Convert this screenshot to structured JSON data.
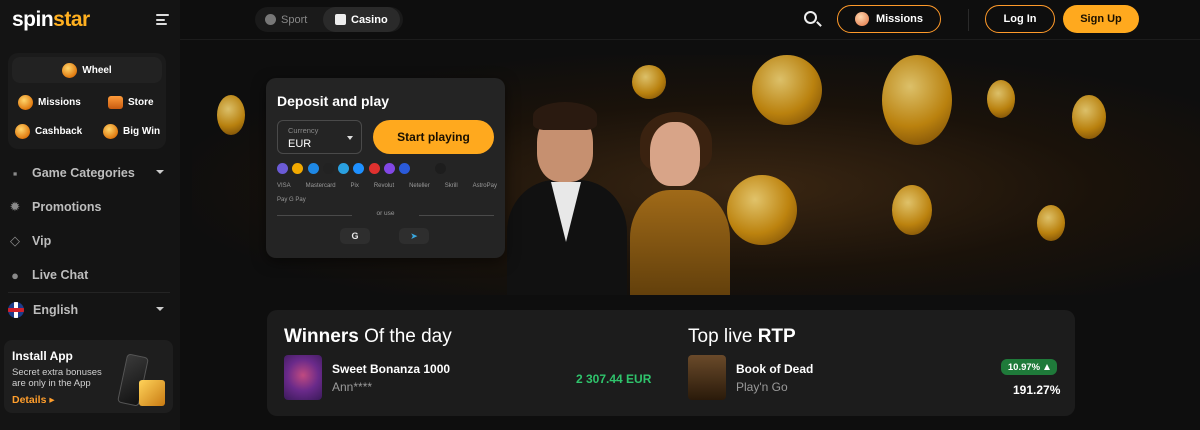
{
  "brand": {
    "logo_prefix": "spin",
    "logo_suffix": "star"
  },
  "sidebar": {
    "promos": [
      {
        "label": "Wheel",
        "icon": "wheel-icon"
      },
      {
        "label": "Missions",
        "icon": "missions-icon"
      },
      {
        "label": "Store",
        "icon": "store-icon"
      },
      {
        "label": "Cashback",
        "icon": "cashback-icon"
      },
      {
        "label": "Big Win",
        "icon": "big-win-icon"
      }
    ],
    "nav": [
      {
        "label": "Game Categories",
        "icon": "grid-icon"
      },
      {
        "label": "Promotions",
        "icon": "gear-icon"
      },
      {
        "label": "Vip",
        "icon": "diamond-icon"
      },
      {
        "label": "Live Chat",
        "icon": "chat-icon"
      }
    ],
    "language": "English",
    "install": {
      "title": "Install App",
      "description": "Secret extra bonuses are only in the App",
      "link": "Details ▸"
    }
  },
  "topbar": {
    "tabs": [
      {
        "label": "Sport",
        "active": false
      },
      {
        "label": "Casino",
        "active": true
      }
    ],
    "missions_label": "Missions",
    "login_label": "Log In",
    "signup_label": "Sign Up"
  },
  "deposit": {
    "title": "Deposit and play",
    "currency_label": "Currency",
    "currency_value": "EUR",
    "start_label": "Start playing",
    "payment_methods": [
      "VISA",
      "Mastercard",
      "Pix",
      "Revolut",
      "Neteller",
      "Skrill",
      "AstroPay"
    ],
    "payment_methods_2": [
      "Pay",
      "G Pay"
    ],
    "or_use": "or use",
    "social": [
      {
        "label": "G",
        "icon": "google-icon"
      },
      {
        "label": "➤",
        "icon": "telegram-icon"
      }
    ],
    "crypto_colors": [
      "#6b5bd6",
      "#f2a900",
      "#1e88e5",
      "#222222",
      "#2aa0e0",
      "#1e90ff",
      "#e0312f",
      "#8247e5",
      "#2a5ada",
      "#1d1d1d"
    ]
  },
  "winners": {
    "title_bold": "Winners",
    "title_rest": " Of the day",
    "game": "Sweet Bonanza 1000",
    "player": "Ann****",
    "amount": "2 307.44 EUR"
  },
  "top_rtp": {
    "title_rest": "Top live ",
    "title_bold": "RTP",
    "game": "Book of Dead",
    "provider": "Play'n Go",
    "badge": "10.97%",
    "value": "191.27%"
  }
}
